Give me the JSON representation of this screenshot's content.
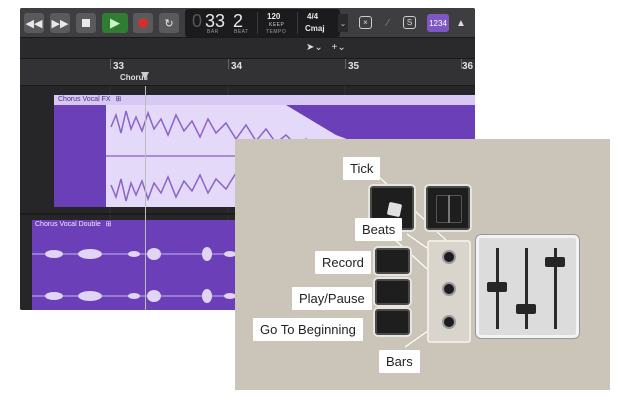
{
  "transport": {
    "buttons": [
      "rewind-button",
      "fast-forward-button",
      "stop-button",
      "play-button",
      "record-button",
      "cycle-button"
    ],
    "bar": "33",
    "beat": "2",
    "bar_label": "BAR",
    "beat_label": "BEAT",
    "tempo_value": "120",
    "tempo_keep": "KEEP",
    "tempo_label": "TEMPO",
    "time_signature": "4/4",
    "key": "Cmaj",
    "count_in": "1234"
  },
  "ruler": {
    "bars": [
      "33",
      "34",
      "35",
      "36"
    ],
    "marker": "Chorus"
  },
  "tracks": [
    {
      "region_name": "Chorus Vocal FX"
    },
    {
      "region_name": "Chorus Vocal Double"
    }
  ],
  "callouts": {
    "tick": "Tick",
    "beats": "Beats",
    "record": "Record",
    "play_pause": "Play/Pause",
    "go_to_beginning": "Go To Beginning",
    "bars": "Bars"
  },
  "colors": {
    "region": "#6b3fb8",
    "waveform": "#e4d9f8",
    "play": "#2e7d32",
    "record": "#d32f2f",
    "panel": "#cbc4b8"
  }
}
